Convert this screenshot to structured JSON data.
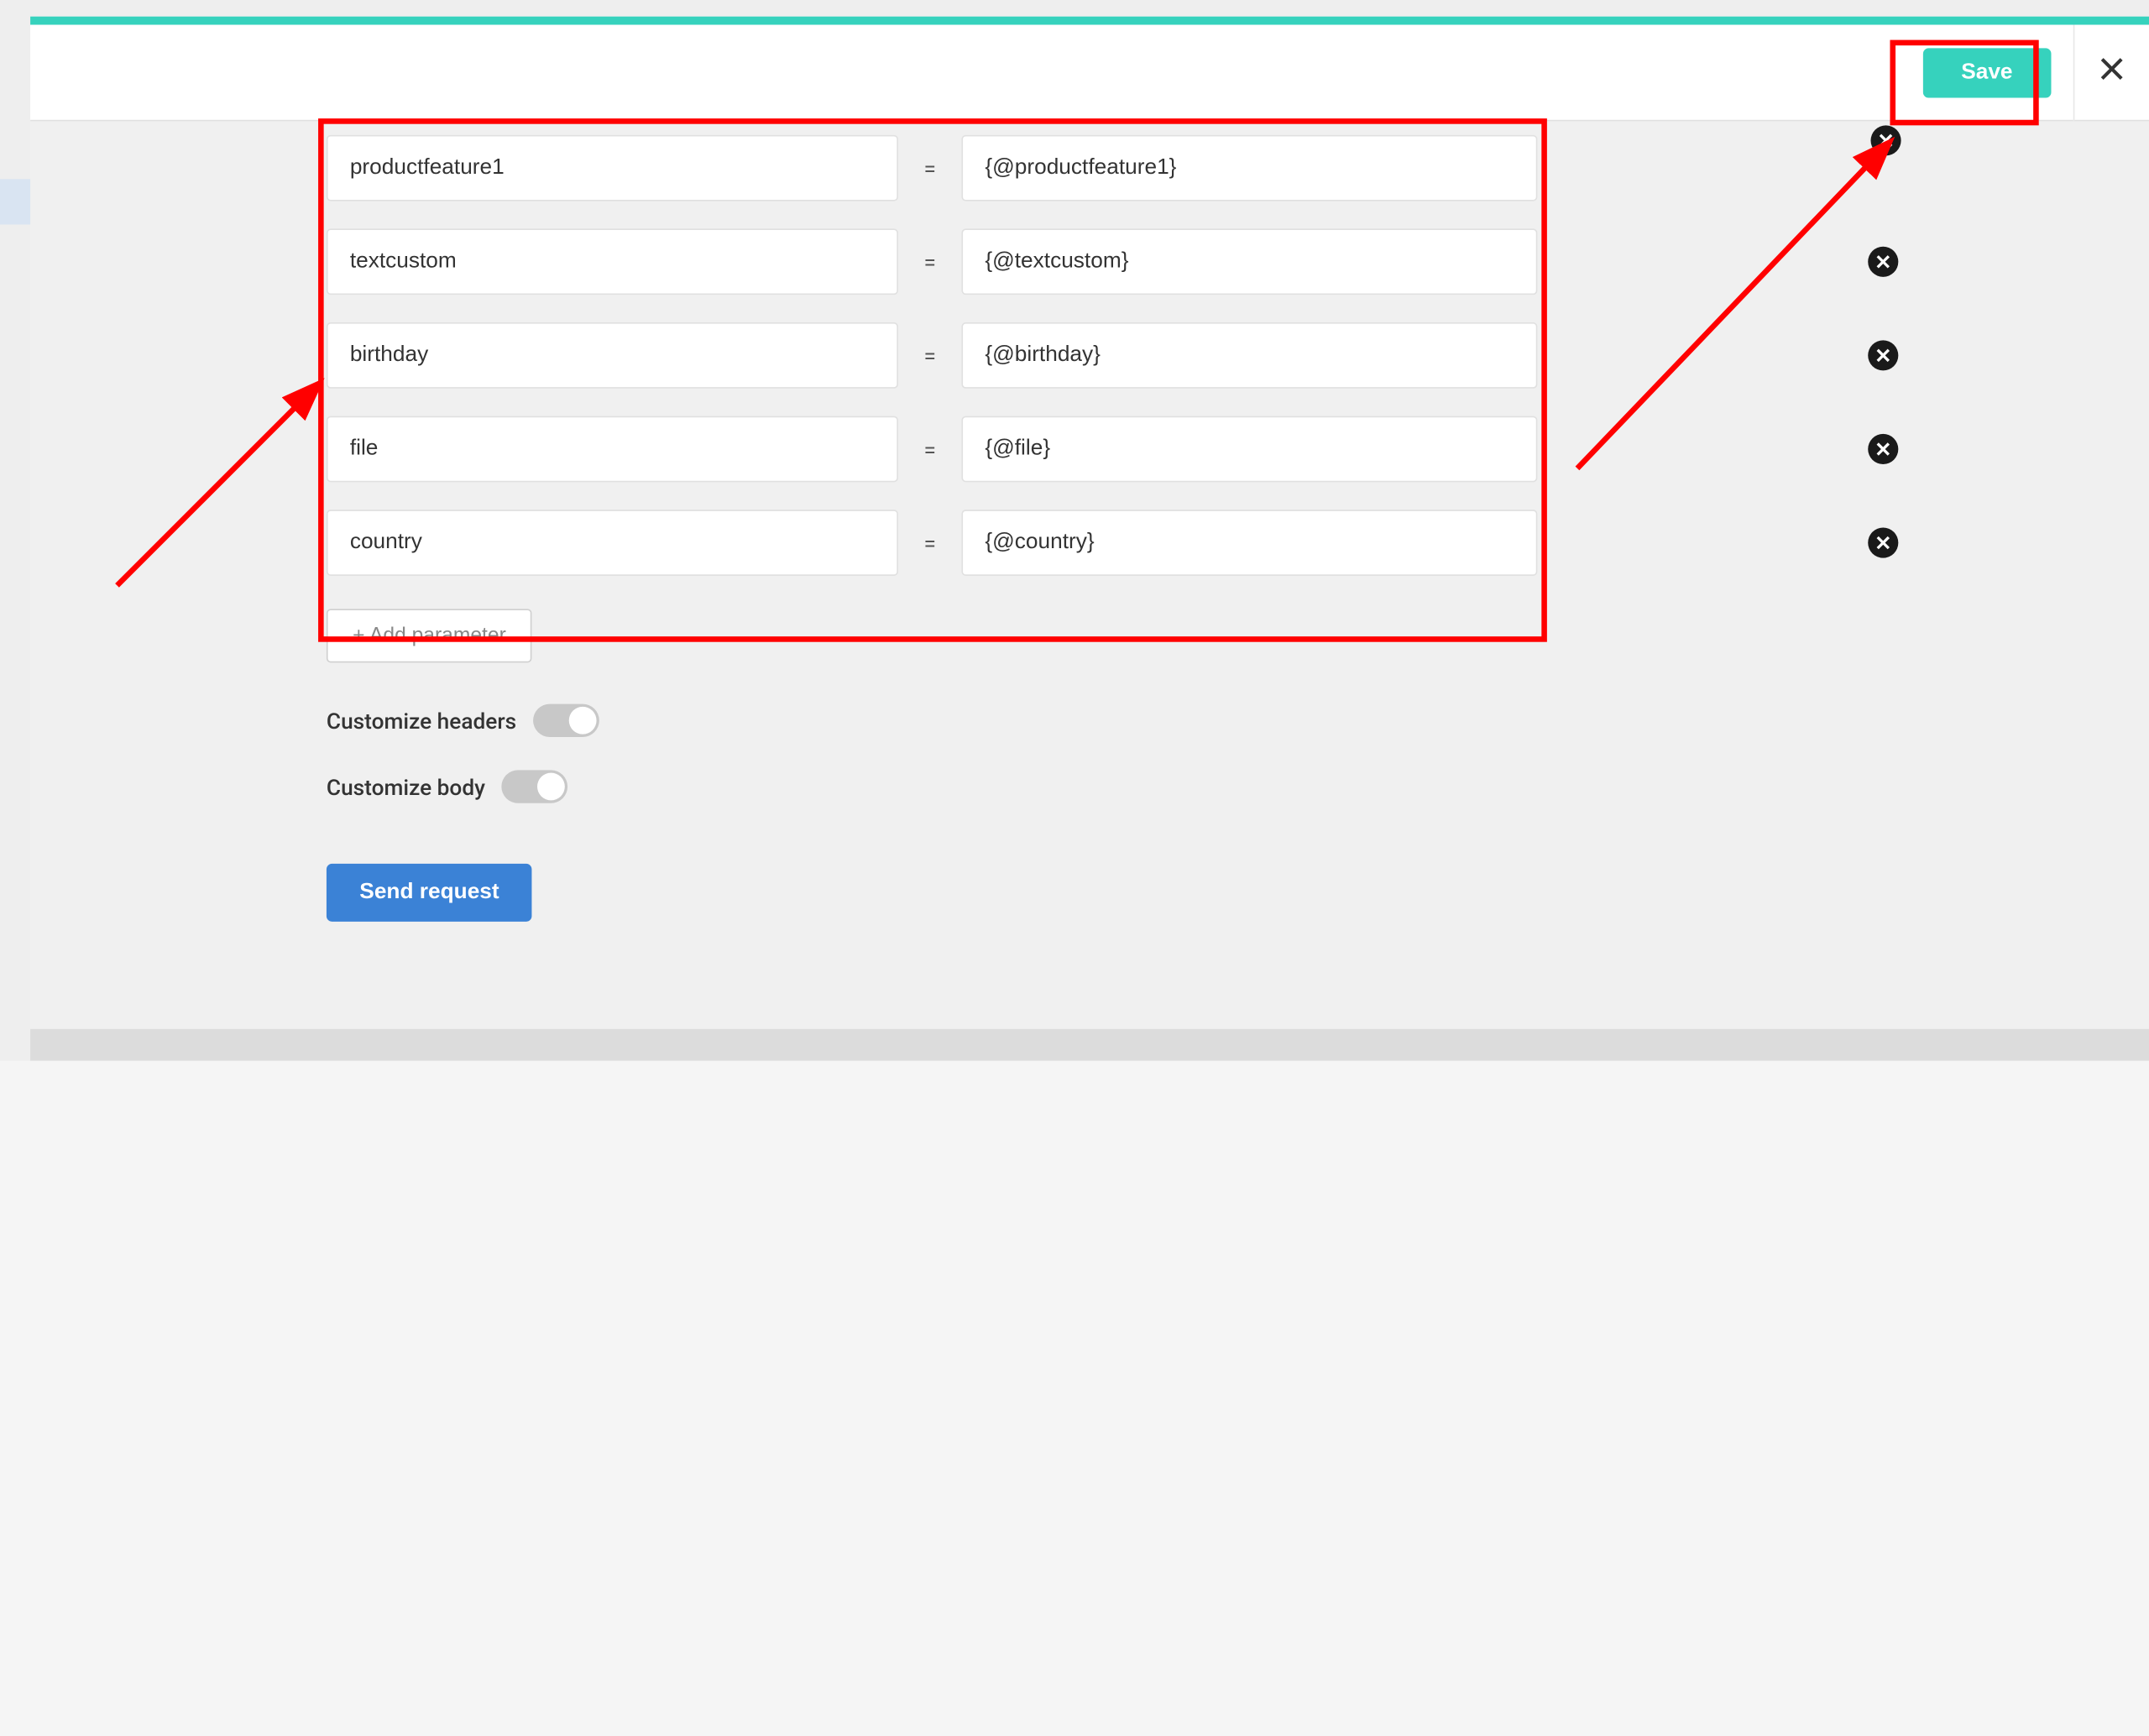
{
  "header": {
    "save_label": "Save"
  },
  "parameters": [
    {
      "key": "productfeature1",
      "value": "{@productfeature1}"
    },
    {
      "key": "textcustom",
      "value": "{@textcustom}"
    },
    {
      "key": "birthday",
      "value": "{@birthday}"
    },
    {
      "key": "file",
      "value": "{@file}"
    },
    {
      "key": "country",
      "value": "{@country}"
    }
  ],
  "equals_sign": "=",
  "add_parameter_label": "+ Add parameter",
  "toggles": {
    "customize_headers_label": "Customize headers",
    "customize_body_label": "Customize body"
  },
  "send_request_label": "Send request"
}
